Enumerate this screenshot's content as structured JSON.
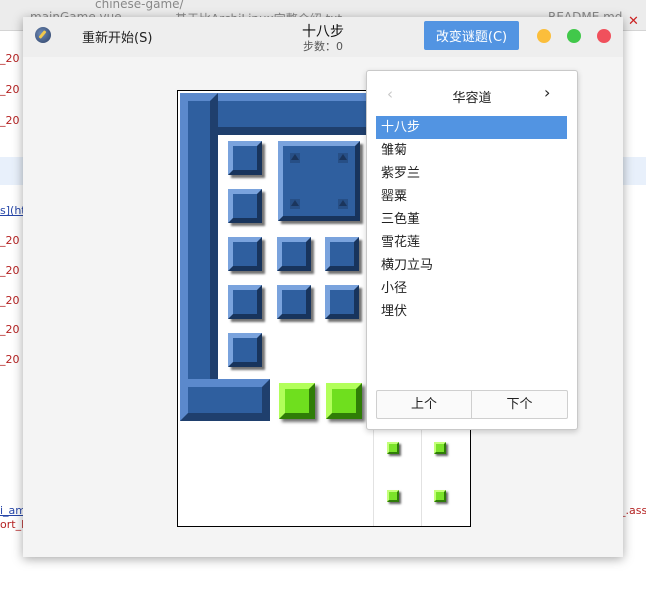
{
  "background_editor": {
    "tabs": [
      "mainGame.vue",
      "基于比ArchiLinux完整介绍.txt",
      "README.md"
    ],
    "path_text": "chinese-game/",
    "code_lines": [
      "_20",
      "_20",
      "_20",
      "s](ht",
      "_20",
      "_20",
      "_20",
      "_20",
      "_20",
      "i_am",
      "ort_I",
      "_.ass"
    ]
  },
  "window": {
    "restart_label": "重新开始(S)",
    "game_title": "十八步",
    "steps_text": "步数：0",
    "change_puzzle_label": "改变谜题(C)"
  },
  "popover": {
    "title": "华容道",
    "prev_glyph": "‹",
    "next_glyph": "›",
    "items": [
      "十八步",
      "雏菊",
      "紫罗兰",
      "罂粟",
      "三色堇",
      "雪花莲",
      "横刀立马",
      "小径",
      "埋伏"
    ],
    "selected_index": 0,
    "prev_button": "上个",
    "next_button": "下个"
  },
  "colors": {
    "accent": "#5294e2",
    "block_blue": "#2f5f9f",
    "block_green": "#6fdf1e",
    "minimize": "#fbbe3b",
    "maximize": "#41c84a",
    "close": "#f0505c"
  }
}
